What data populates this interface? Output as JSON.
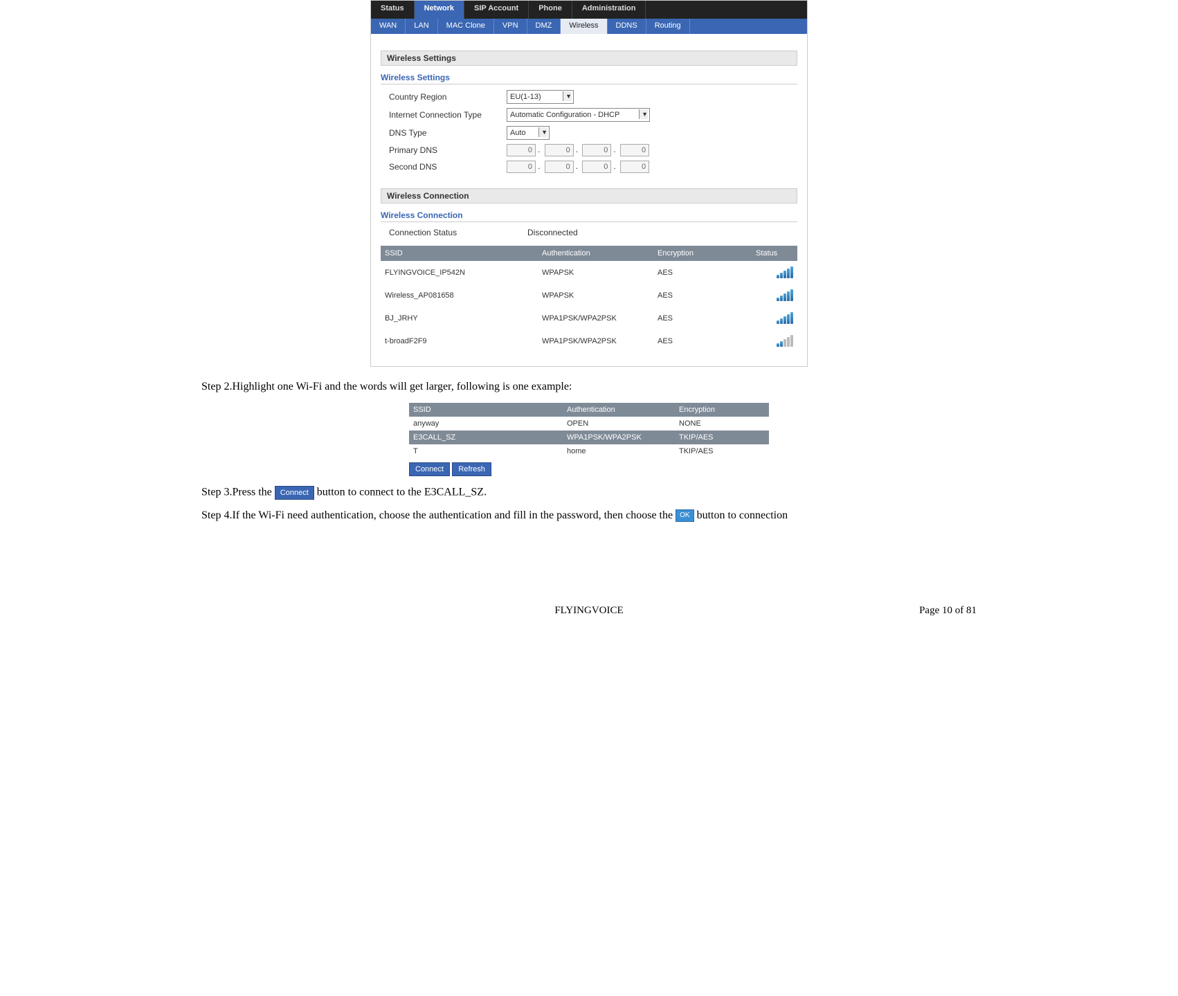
{
  "ui1": {
    "main_tabs": [
      "Status",
      "Network",
      "SIP Account",
      "Phone",
      "Administration"
    ],
    "main_tab_active_index": 1,
    "sub_tabs": [
      "WAN",
      "LAN",
      "MAC Clone",
      "VPN",
      "DMZ",
      "Wireless",
      "DDNS",
      "Routing"
    ],
    "sub_tab_active_index": 5,
    "wireless_settings": {
      "section_bar": "Wireless Settings",
      "fieldset_title": "Wireless Settings",
      "rows": {
        "country_region_label": "Country Region",
        "country_region_value": "EU(1-13)",
        "internet_conn_type_label": "Internet Connection Type",
        "internet_conn_type_value": "Automatic Configuration - DHCP",
        "dns_type_label": "DNS Type",
        "dns_type_value": "Auto",
        "primary_dns_label": "Primary DNS",
        "primary_dns_segments": [
          "0",
          "0",
          "0",
          "0"
        ],
        "second_dns_label": "Second DNS",
        "second_dns_segments": [
          "0",
          "0",
          "0",
          "0"
        ]
      }
    },
    "wireless_connection": {
      "section_bar": "Wireless Connection",
      "fieldset_title": "Wireless Connection",
      "connection_status_label": "Connection Status",
      "connection_status_value": "Disconnected",
      "table_headers": {
        "ssid": "SSID",
        "auth": "Authentication",
        "enc": "Encryption",
        "status": "Status"
      },
      "networks": [
        {
          "ssid": "FLYINGVOICE_IP542N",
          "auth": "WPAPSK",
          "enc": "AES",
          "signal": "full"
        },
        {
          "ssid": "Wireless_AP081658",
          "auth": "WPAPSK",
          "enc": "AES",
          "signal": "full"
        },
        {
          "ssid": "BJ_JRHY",
          "auth": "WPA1PSK/WPA2PSK",
          "enc": "AES",
          "signal": "full"
        },
        {
          "ssid": "t-broadF2F9",
          "auth": "WPA1PSK/WPA2PSK",
          "enc": "AES",
          "signal": "partial"
        }
      ]
    }
  },
  "step2_text": "Step 2.Highlight one Wi-Fi and the words will get larger, following is one example:",
  "ui2": {
    "headers": {
      "ssid": "SSID",
      "auth": "Authentication",
      "enc": "Encryption"
    },
    "rows": [
      {
        "ssid": "anyway",
        "auth": "OPEN",
        "enc": "NONE",
        "selected": false
      },
      {
        "ssid": "E3CALL_SZ",
        "auth": "WPA1PSK/WPA2PSK",
        "enc": "TKIP/AES",
        "selected": true
      },
      {
        "ssid": "T",
        "auth": "home",
        "enc": "TKIP/AES",
        "selected": false
      }
    ],
    "connect_btn": "Connect",
    "refresh_btn": "Refresh"
  },
  "step3": {
    "prefix": "Step 3.Press the ",
    "btn": "Connect",
    "suffix": " button to connect to the E3CALL_SZ."
  },
  "step4": {
    "prefix": "Step 4.If the Wi-Fi need authentication, choose the authentication and fill in the password, then choose the ",
    "btn": "OK",
    "suffix": " button to connection"
  },
  "footer": {
    "center": "FLYINGVOICE",
    "right": "Page 10 of 81"
  }
}
